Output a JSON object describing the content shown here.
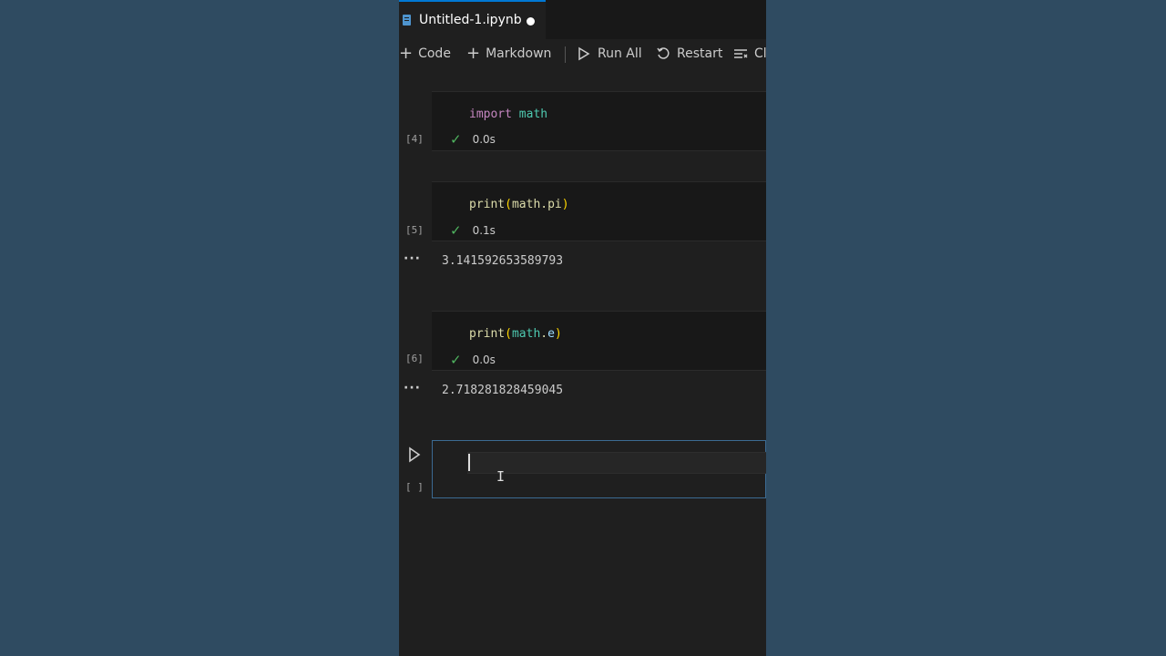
{
  "tab": {
    "title": "Untitled-1.ipynb",
    "dirty_icon": "unsaved-dot-icon"
  },
  "toolbar": {
    "code_label": "Code",
    "markdown_label": "Markdown",
    "run_all_label": "Run All",
    "restart_label": "Restart",
    "clear_label": "Cl"
  },
  "cells": [
    {
      "exec": "[4]",
      "code_kw": "import",
      "code_mod": "math",
      "time": "0.0s"
    },
    {
      "exec": "[5]",
      "code_fn": "print",
      "code_open": "(",
      "code_body": "math.pi",
      "code_close": ")",
      "time": "0.1s",
      "output": "3.141592653589793"
    },
    {
      "exec": "[6]",
      "code_fn": "print",
      "code_open": "(",
      "code_mod": "math",
      "code_dot": ".",
      "code_attr": "e",
      "code_close": ")",
      "time": "0.0s",
      "output": "2.718281828459045"
    }
  ],
  "empty_cell": {
    "exec": "[ ]"
  },
  "colors": {
    "accent": "#0078d4",
    "success": "#4fb35f",
    "background": "#2f4a60"
  }
}
